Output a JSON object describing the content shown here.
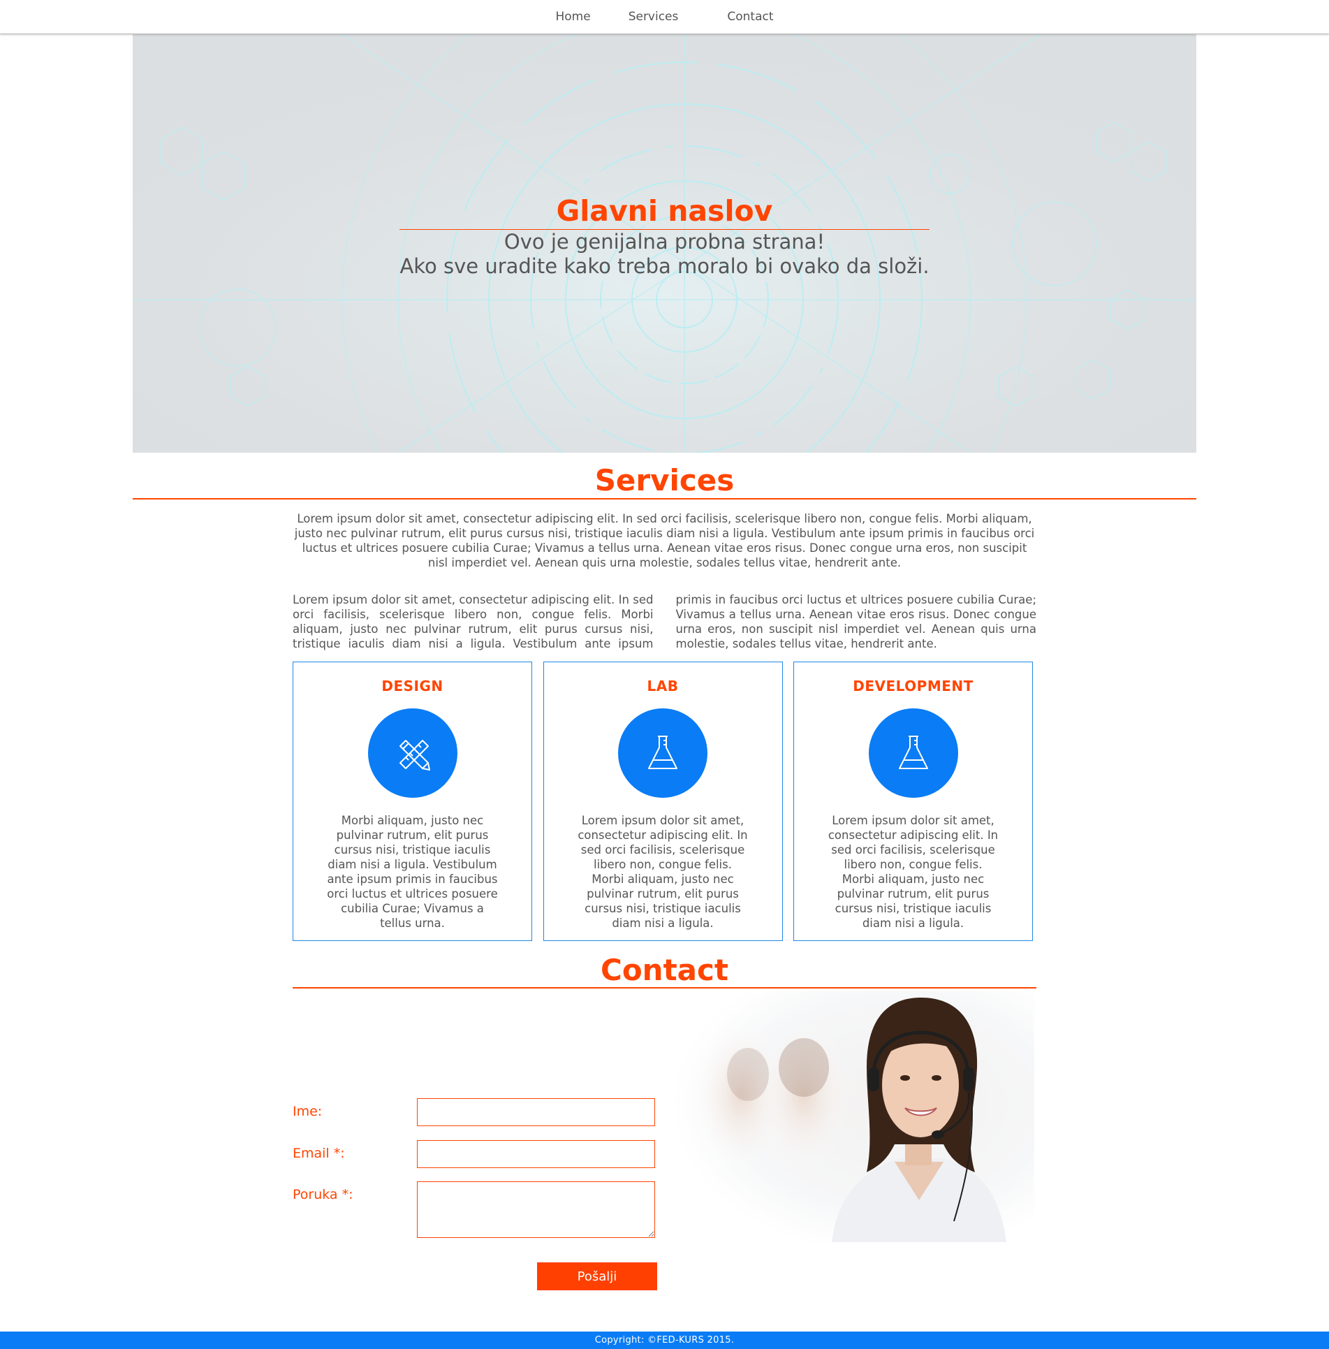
{
  "nav": {
    "items": [
      {
        "label": "Home"
      },
      {
        "label": "Services"
      },
      {
        "label": "Contact"
      }
    ]
  },
  "hero": {
    "title": "Glavni naslov",
    "line1": "Ovo je genijalna probna strana!",
    "line2": "Ako sve uradite kako treba moralo bi ovako da složi."
  },
  "services": {
    "title": "Services",
    "lead": "Lorem ipsum dolor sit amet, consectetur adipiscing elit. In sed orci facilisis, scelerisque libero non, congue felis. Morbi aliquam, justo nec pulvinar rutrum, elit purus cursus nisi, tristique iaculis diam nisi a ligula. Vestibulum ante ipsum primis in faucibus orci luctus et ultrices posuere cubilia Curae; Vivamus a tellus urna. Aenean vitae eros risus. Donec congue urna eros, non suscipit nisl imperdiet vel. Aenean quis urna molestie, sodales tellus vitae, hendrerit ante.",
    "columns_text": "Lorem ipsum dolor sit amet, consectetur adipiscing elit. In sed orci facilisis, scelerisque libero non, congue felis. Morbi aliquam, justo nec pulvinar rutrum, elit purus cursus nisi, tristique iaculis diam nisi a ligula. Vestibulum ante ipsum primis in faucibus orci luctus et ultrices posuere cubilia Curae; Vivamus a tellus urna. Aenean vitae eros risus. Donec congue urna eros, non suscipit nisl imperdiet vel. Aenean quis urna molestie, sodales tellus vitae, hendrerit ante.",
    "cards": [
      {
        "title": "DESIGN",
        "icon": "pencil-ruler-icon",
        "text": "Morbi aliquam, justo nec pulvinar rutrum, elit purus cursus nisi, tristique iaculis diam nisi a ligula. Vestibulum ante ipsum primis in faucibus orci luctus et ultrices posuere cubilia Curae; Vivamus a tellus urna."
      },
      {
        "title": "LAB",
        "icon": "flask-icon",
        "text": "Lorem ipsum dolor sit amet, consectetur adipiscing elit. In sed orci facilisis, scelerisque libero non, congue felis. Morbi aliquam, justo nec pulvinar rutrum, elit purus cursus nisi, tristique iaculis diam nisi a ligula."
      },
      {
        "title": "DEVELOPMENT",
        "icon": "flask-icon",
        "text": "Lorem ipsum dolor sit amet, consectetur adipiscing elit. In sed orci facilisis, scelerisque libero non, congue felis. Morbi aliquam, justo nec pulvinar rutrum, elit purus cursus nisi, tristique iaculis diam nisi a ligula."
      }
    ]
  },
  "contact": {
    "title": "Contact",
    "name_label": "Ime:",
    "name_value": "",
    "email_label": "Email *:",
    "email_value": "",
    "message_label": "Poruka *:",
    "message_value": "",
    "submit_label": "Pošalji"
  },
  "footer": {
    "text": "Copyright: ©FED-KURS 2015."
  },
  "colors": {
    "accent": "#ff4500",
    "blue": "#0a7cf5",
    "text": "#555555"
  }
}
